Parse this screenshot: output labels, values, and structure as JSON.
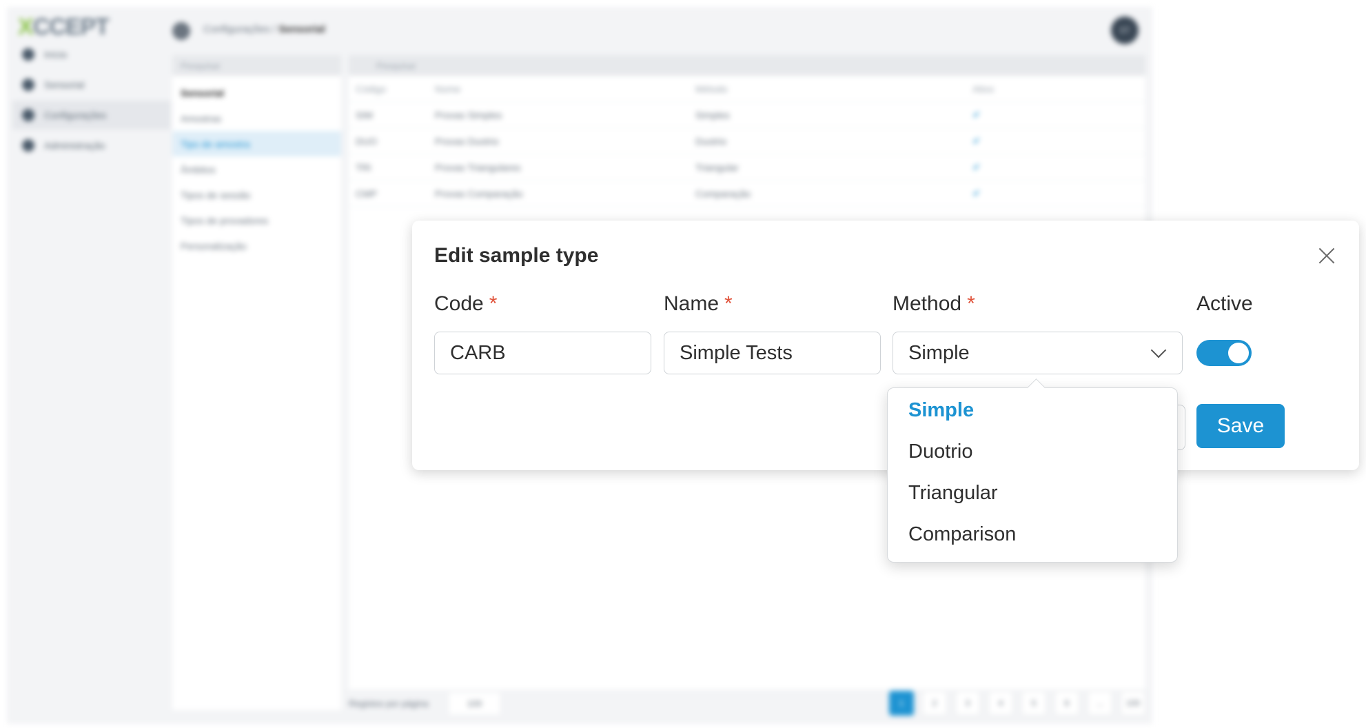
{
  "background_app": {
    "logo": "CCEPT",
    "logo_prefix": "X",
    "nav": [
      "Início",
      "Sensorial",
      "Configurações",
      "Administração"
    ],
    "breadcrumb": {
      "parent": "Configurações",
      "current": "Sensorial"
    },
    "avatar_initials": "ST",
    "side_search_placeholder": "Pesquisar",
    "side_header": "Sensorial",
    "side_items": [
      "Amostras",
      "Tipo de amostra",
      "Âmbitos",
      "Tipos de sessão",
      "Tipos de provadores",
      "Personalização"
    ],
    "table_search_placeholder": "Pesquisar",
    "columns": [
      "Código",
      "Nome",
      "Método",
      "Ativo"
    ],
    "rows": [
      [
        "SIM",
        "Provas Simples",
        "Simples",
        "✔"
      ],
      [
        "DUO",
        "Provas Duotrio",
        "Duotrio",
        "✔"
      ],
      [
        "TRI",
        "Provas Triangulares",
        "Triangular",
        "✔"
      ],
      [
        "CMP",
        "Provas Comparação",
        "Comparação",
        "✔"
      ]
    ],
    "pager_label": "Registos por página",
    "pager_size": "100",
    "pages": [
      "1",
      "2",
      "3",
      "4",
      "5",
      "6",
      "...",
      "100"
    ]
  },
  "modal": {
    "title": "Edit sample type",
    "code_label": "Code",
    "name_label": "Name",
    "method_label": "Method",
    "active_label": "Active",
    "required_mark": "*",
    "code_value": "CARB",
    "name_value": "Simple Tests",
    "method_value": "Simple",
    "active": true,
    "save_label": "Save",
    "accent_color": "#1d93d2"
  },
  "dropdown": {
    "options": [
      "Simple",
      "Duotrio",
      "Triangular",
      "Comparison"
    ],
    "selected": "Simple"
  }
}
